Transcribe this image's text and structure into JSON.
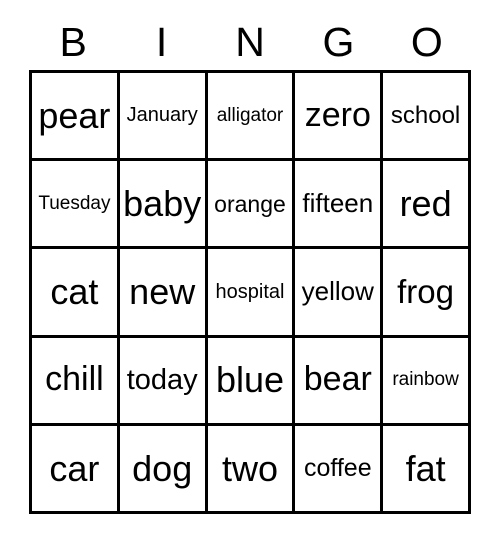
{
  "card": {
    "title": "BINGO",
    "columns": 5,
    "rows": 5,
    "background_color": "#ffffff",
    "border_color": "#000000",
    "text_color": "#000000",
    "border_width_px": 3
  },
  "header": {
    "letters": [
      {
        "label": "B",
        "column": 1
      },
      {
        "label": "I",
        "column": 2
      },
      {
        "label": "N",
        "column": 3
      },
      {
        "label": "G",
        "column": 4
      },
      {
        "label": "O",
        "column": 5
      }
    ],
    "font_size_px": 41
  },
  "grid": {
    "rows": [
      {
        "cells": [
          {
            "text": "pear",
            "font_size_px": 36
          },
          {
            "text": "January",
            "font_size_px": 20
          },
          {
            "text": "alligator",
            "font_size_px": 19
          },
          {
            "text": "zero",
            "font_size_px": 34
          },
          {
            "text": "school",
            "font_size_px": 24
          }
        ]
      },
      {
        "cells": [
          {
            "text": "Tuesday",
            "font_size_px": 19
          },
          {
            "text": "baby",
            "font_size_px": 36
          },
          {
            "text": "orange",
            "font_size_px": 23
          },
          {
            "text": "fifteen",
            "font_size_px": 26
          },
          {
            "text": "red",
            "font_size_px": 36
          }
        ]
      },
      {
        "cells": [
          {
            "text": "cat",
            "font_size_px": 36
          },
          {
            "text": "new",
            "font_size_px": 36
          },
          {
            "text": "hospital",
            "font_size_px": 20
          },
          {
            "text": "yellow",
            "font_size_px": 26
          },
          {
            "text": "frog",
            "font_size_px": 33
          }
        ]
      },
      {
        "cells": [
          {
            "text": "chill",
            "font_size_px": 34
          },
          {
            "text": "today",
            "font_size_px": 29
          },
          {
            "text": "blue",
            "font_size_px": 36
          },
          {
            "text": "bear",
            "font_size_px": 34
          },
          {
            "text": "rainbow",
            "font_size_px": 19
          }
        ]
      },
      {
        "cells": [
          {
            "text": "car",
            "font_size_px": 36
          },
          {
            "text": "dog",
            "font_size_px": 36
          },
          {
            "text": "two",
            "font_size_px": 36
          },
          {
            "text": "coffee",
            "font_size_px": 25
          },
          {
            "text": "fat",
            "font_size_px": 36
          }
        ]
      }
    ]
  }
}
